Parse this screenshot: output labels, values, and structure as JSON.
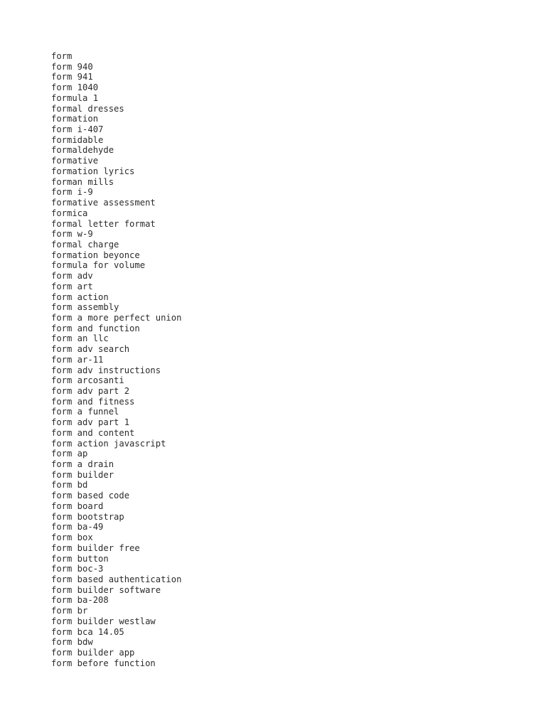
{
  "document": {
    "type": "plain-text-list",
    "background_color": "#ffffff",
    "text_color": "#2b2b2b",
    "font_style": "monospace",
    "line_count": 60,
    "lines": [
      "form",
      "form 940",
      "form 941",
      "form 1040",
      "formula 1",
      "formal dresses",
      "formation",
      "form i-407",
      "formidable",
      "formaldehyde",
      "formative",
      "formation lyrics",
      "forman mills",
      "form i-9",
      "formative assessment",
      "formica",
      "formal letter format",
      "form w-9",
      "formal charge",
      "formation beyonce",
      "formula for volume",
      "form adv",
      "form art",
      "form action",
      "form assembly",
      "form a more perfect union",
      "form and function",
      "form an llc",
      "form adv search",
      "form ar-11",
      "form adv instructions",
      "form arcosanti",
      "form adv part 2",
      "form and fitness",
      "form a funnel",
      "form adv part 1",
      "form and content",
      "form action javascript",
      "form ap",
      "form a drain",
      "form builder",
      "form bd",
      "form based code",
      "form board",
      "form bootstrap",
      "form ba-49",
      "form box",
      "form builder free",
      "form button",
      "form boc-3",
      "form based authentication",
      "form builder software",
      "form ba-208",
      "form br",
      "form builder westlaw",
      "form bca 14.05",
      "form bdw",
      "form builder app",
      "form before function"
    ]
  }
}
